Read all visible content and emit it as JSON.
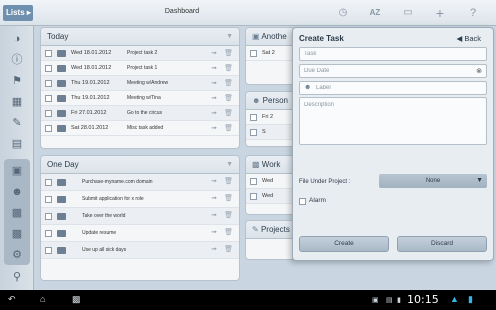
{
  "topbar": {
    "lists_label": "Lists ▸",
    "title": "Dashboard",
    "sort_label": "AZ",
    "add_label": "+",
    "help_label": "?"
  },
  "panels": {
    "today": {
      "title": "Today",
      "rows": [
        {
          "date": "Wed 18.01.2012",
          "title": "Project task 2"
        },
        {
          "date": "Wed 18.01.2012",
          "title": "Project task 1"
        },
        {
          "date": "Thu 19.01.2012",
          "title": "Meeting w/Andrew"
        },
        {
          "date": "Thu 19.01.2012",
          "title": "Meeting w/Tina"
        },
        {
          "date": "Fri 27.01.2012",
          "title": "Go to the circus"
        },
        {
          "date": "Sat 28.01.2012",
          "title": "Misc task added"
        }
      ]
    },
    "one_day": {
      "title": "One Day",
      "rows": [
        {
          "title": "Purchase-myname.com domain"
        },
        {
          "title": "Submit application for x role"
        },
        {
          "title": "Take over the world"
        },
        {
          "title": "Update resume"
        },
        {
          "title": "Use up all sick days"
        }
      ]
    },
    "another": {
      "title": "Anothe",
      "row_date": "Sat 2"
    },
    "personal": {
      "title": "Person",
      "rows": [
        "Fri 2",
        "S"
      ]
    },
    "work": {
      "title": "Work",
      "rows": [
        "Wed",
        "Wed"
      ]
    },
    "projects": {
      "title": "Projects"
    }
  },
  "dialog": {
    "title": "Create Task",
    "back_label": "Back",
    "task_placeholder": "Task",
    "due_date_placeholder": "Due Date",
    "label_placeholder": "Label",
    "description_placeholder": "Description",
    "file_under_label": "File Under Project :",
    "file_under_value": "None",
    "alarm_label": "Alarm",
    "create_label": "Create",
    "discard_label": "Discard"
  },
  "status_bar": {
    "clock": "10:15"
  },
  "colors": {
    "accent": "#6f8fae",
    "background": "#c9d6e2"
  }
}
